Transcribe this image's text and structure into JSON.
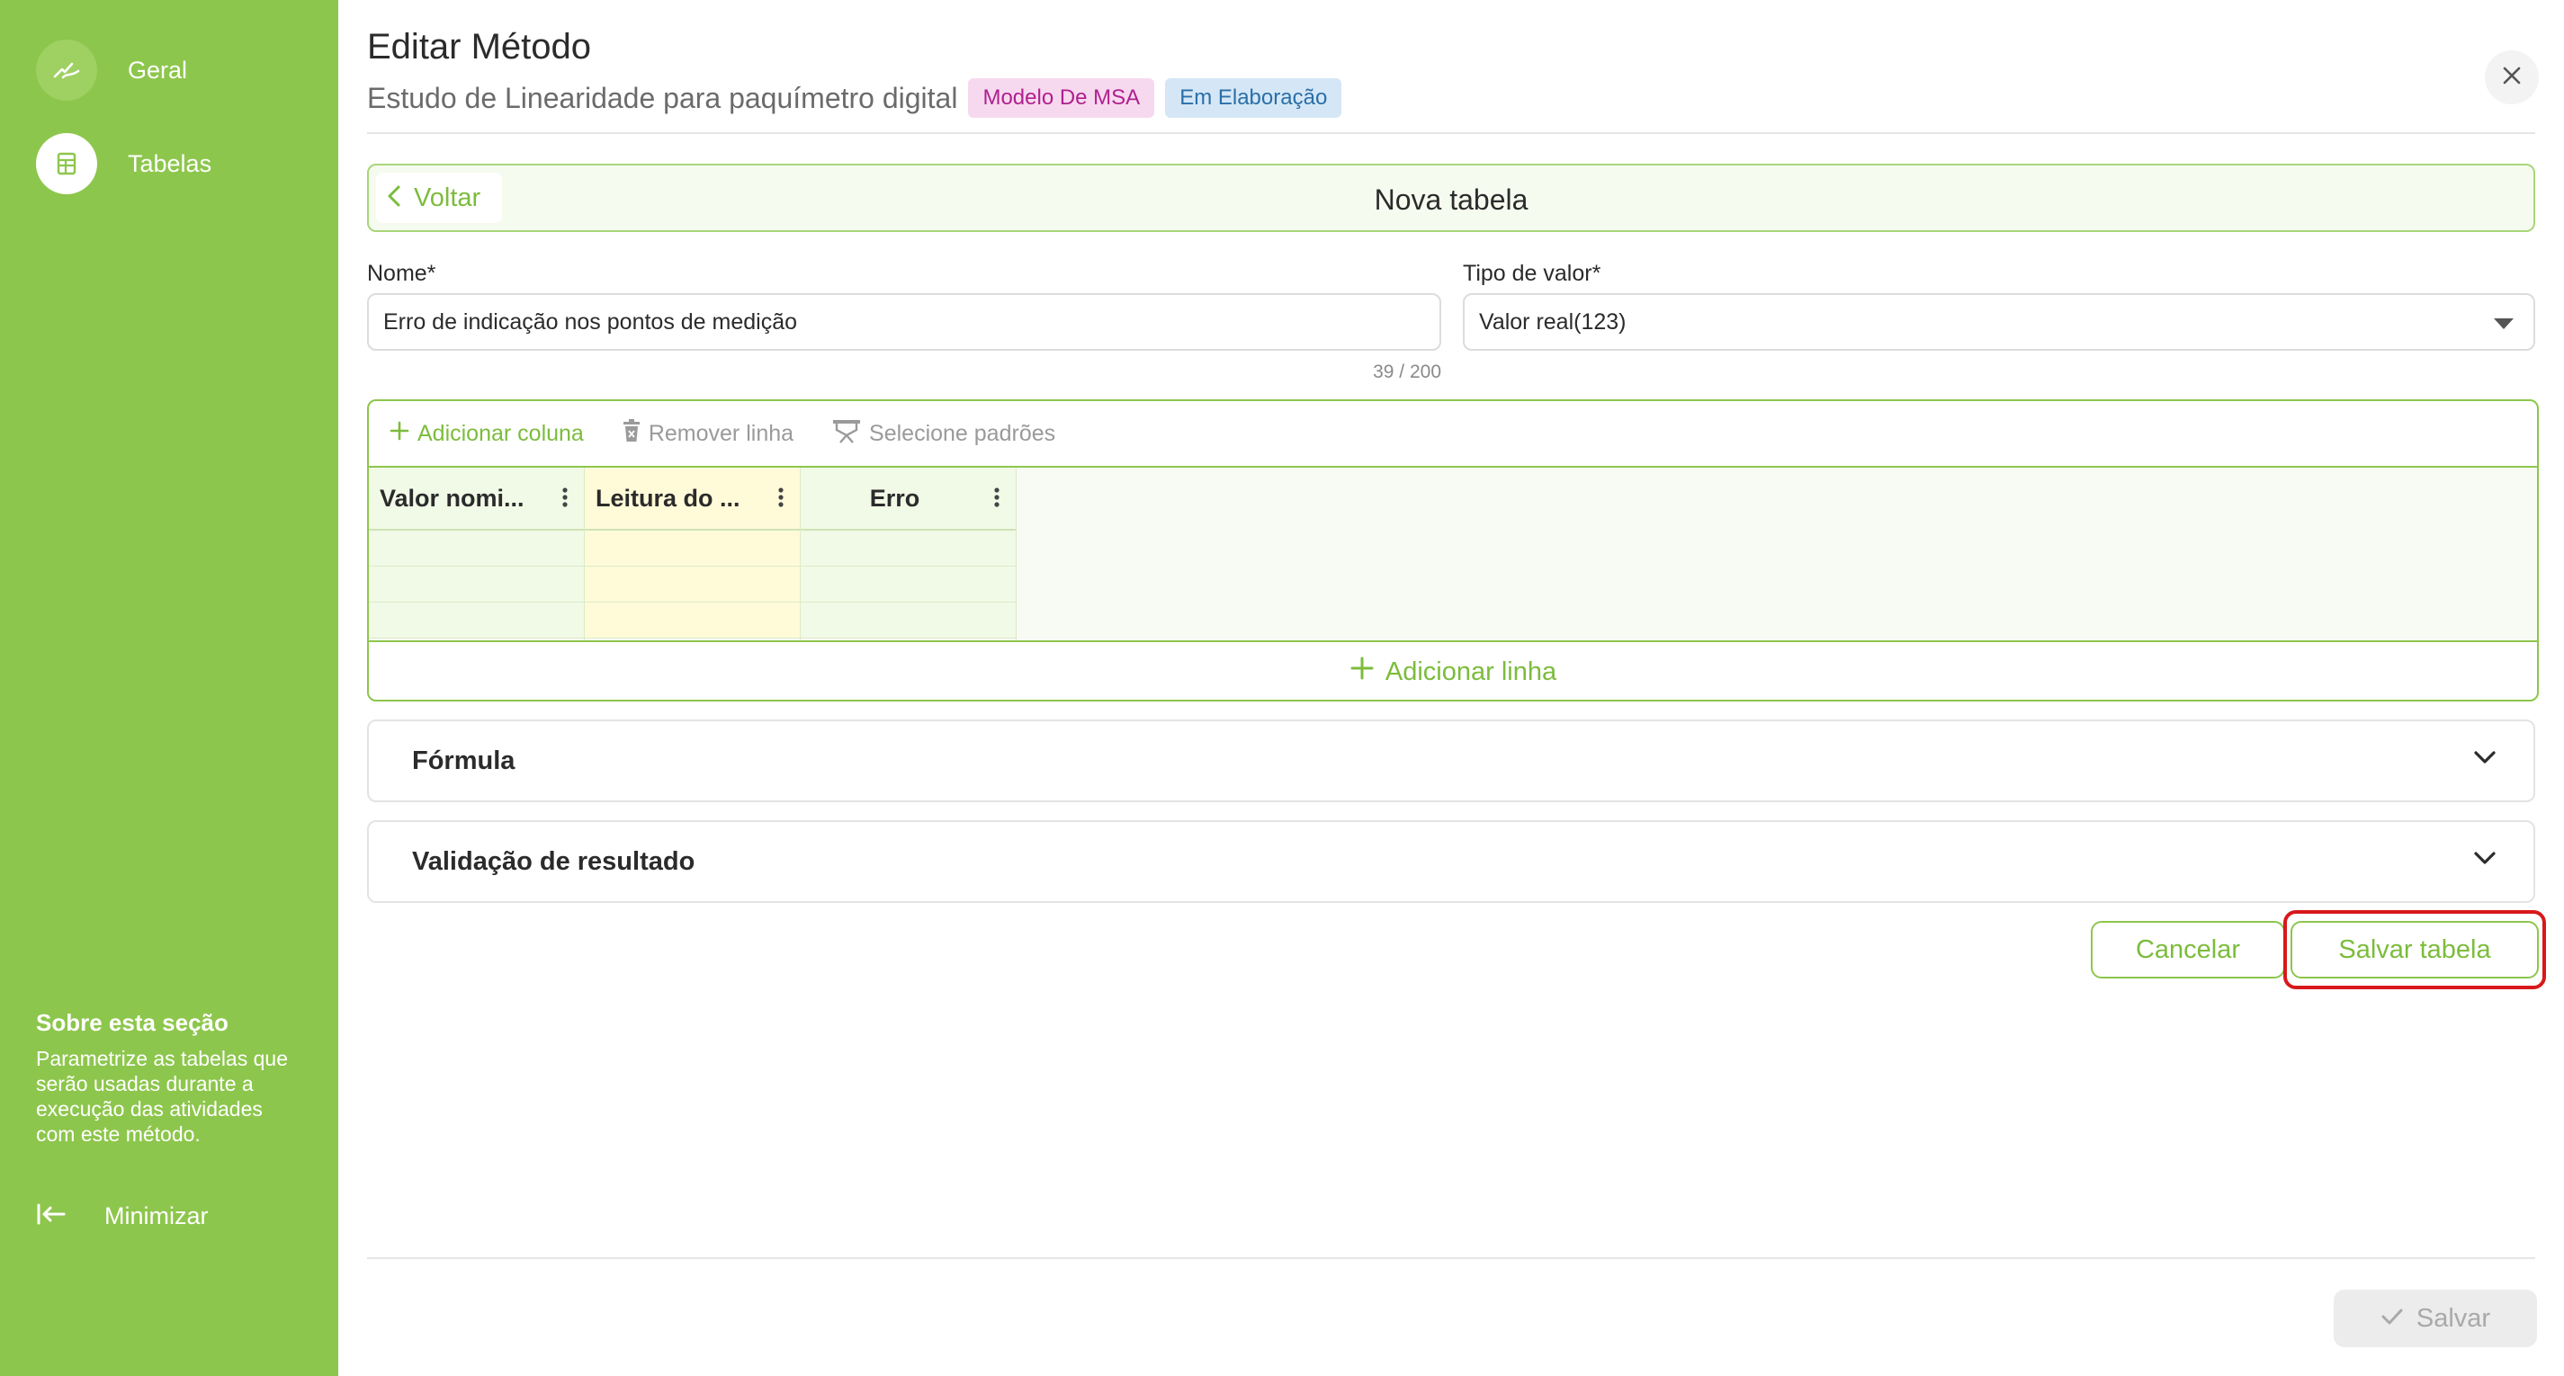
{
  "sidebar": {
    "items": [
      {
        "label": "Geral",
        "icon": "signature-icon",
        "active": false
      },
      {
        "label": "Tabelas",
        "icon": "table-icon",
        "active": true
      }
    ],
    "about_title": "Sobre esta seção",
    "about_text": "Parametrize as tabelas que serão usadas durante a execução das atividades com este método.",
    "minimize_label": "Minimizar"
  },
  "header": {
    "title": "Editar Método",
    "subtitle": "Estudo de Linearidade para paquímetro digital",
    "badges": [
      {
        "label": "Modelo De MSA",
        "color": "#b0208f"
      },
      {
        "label": "Em Elaboração",
        "color": "#2a6fa8"
      }
    ]
  },
  "table_bar": {
    "back_label": "Voltar",
    "title": "Nova tabela"
  },
  "form": {
    "name_label": "Nome*",
    "name_value": "Erro de indicação nos pontos de medição",
    "name_counter": "39 / 200",
    "type_label": "Tipo de valor*",
    "type_value": "Valor real(123)"
  },
  "editor": {
    "toolbar": {
      "add_column": "Adicionar coluna",
      "remove_row": "Remover linha",
      "select_standards": "Selecione padrões"
    },
    "columns": [
      "Valor nomi...",
      "Leitura do ...",
      "Erro"
    ],
    "add_row": "Adicionar linha"
  },
  "accordions": {
    "formula": "Fórmula",
    "validation": "Validação de resultado"
  },
  "actions": {
    "cancel": "Cancelar",
    "save_table": "Salvar tabela",
    "save": "Salvar"
  },
  "colors": {
    "sidebar": "#8dc64c",
    "accent": "#7cbc3c",
    "highlight": "#d8191b"
  }
}
